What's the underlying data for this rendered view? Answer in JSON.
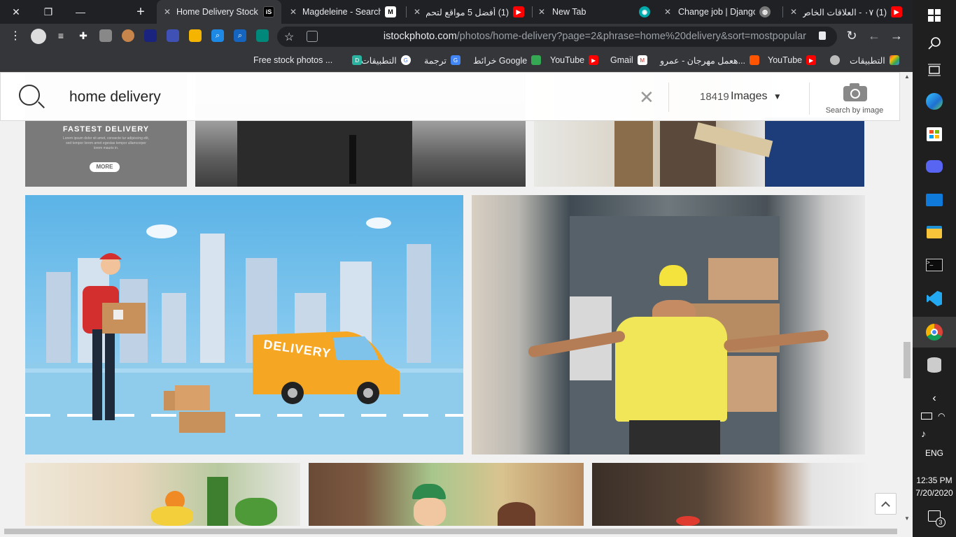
{
  "window": {
    "controls": {
      "close": "✕",
      "restore": "❐",
      "minimize": "—"
    },
    "new_tab": "+"
  },
  "tabs": [
    {
      "label": "Home Delivery Stock",
      "favicon": "iS",
      "active": true
    },
    {
      "label": "Magdeleine - Search",
      "favicon": "M",
      "active": false
    },
    {
      "label": "(1) أفضل 5 مواقع لتحم",
      "favicon": "youtube-icon",
      "active": false
    },
    {
      "label": "New Tab",
      "favicon": "chrome-icon",
      "active": false
    },
    {
      "label": "Change job | Django",
      "favicon": "django-icon",
      "active": false
    },
    {
      "label": "(1) ٠٧ - العلاقات الخاص",
      "favicon": "youtube-icon",
      "active": false
    }
  ],
  "toolbar": {
    "url_host": "istockphoto.com",
    "url_path": "/photos/home-delivery?page=2&phrase=home%20delivery&sort=mostpopular"
  },
  "bookmarks": [
    {
      "label": "التطبيقات",
      "icon": "apps-grid-icon"
    },
    {
      "label": "",
      "icon": "globe-icon"
    },
    {
      "label": "YouTube",
      "icon": "youtube-icon"
    },
    {
      "label": "هعمل مهرجان - عمرو...",
      "icon": "soundcloud-icon"
    },
    {
      "label": "Gmail",
      "icon": "gmail-icon"
    },
    {
      "label": "YouTube",
      "icon": "youtube-icon"
    },
    {
      "label": "خرائط Google",
      "icon": "maps-icon"
    },
    {
      "label": "ترجمة",
      "icon": "translate-icon"
    },
    {
      "label": "التطبيقات",
      "icon": "google-icon"
    },
    {
      "label": "Free stock photos ...",
      "icon": "dribbble-icon"
    }
  ],
  "search": {
    "query": "home delivery",
    "result_count": "18419",
    "result_type": "Images",
    "search_by_image": "Search by image"
  },
  "promo": {
    "title": "FASTEST DELIVERY",
    "body": "Lorem ipsum dolor sit amet, consecte tur adipiscing elit, sed tempor lorem amet egestas tempor ullamcorper lorem mauris in.",
    "more": "MORE"
  },
  "illustration": {
    "van_text": "DELIVERY"
  },
  "taskbar": {
    "language": "ENG",
    "time": "12:35 PM",
    "date": "7/20/2020",
    "notifications": "3"
  }
}
